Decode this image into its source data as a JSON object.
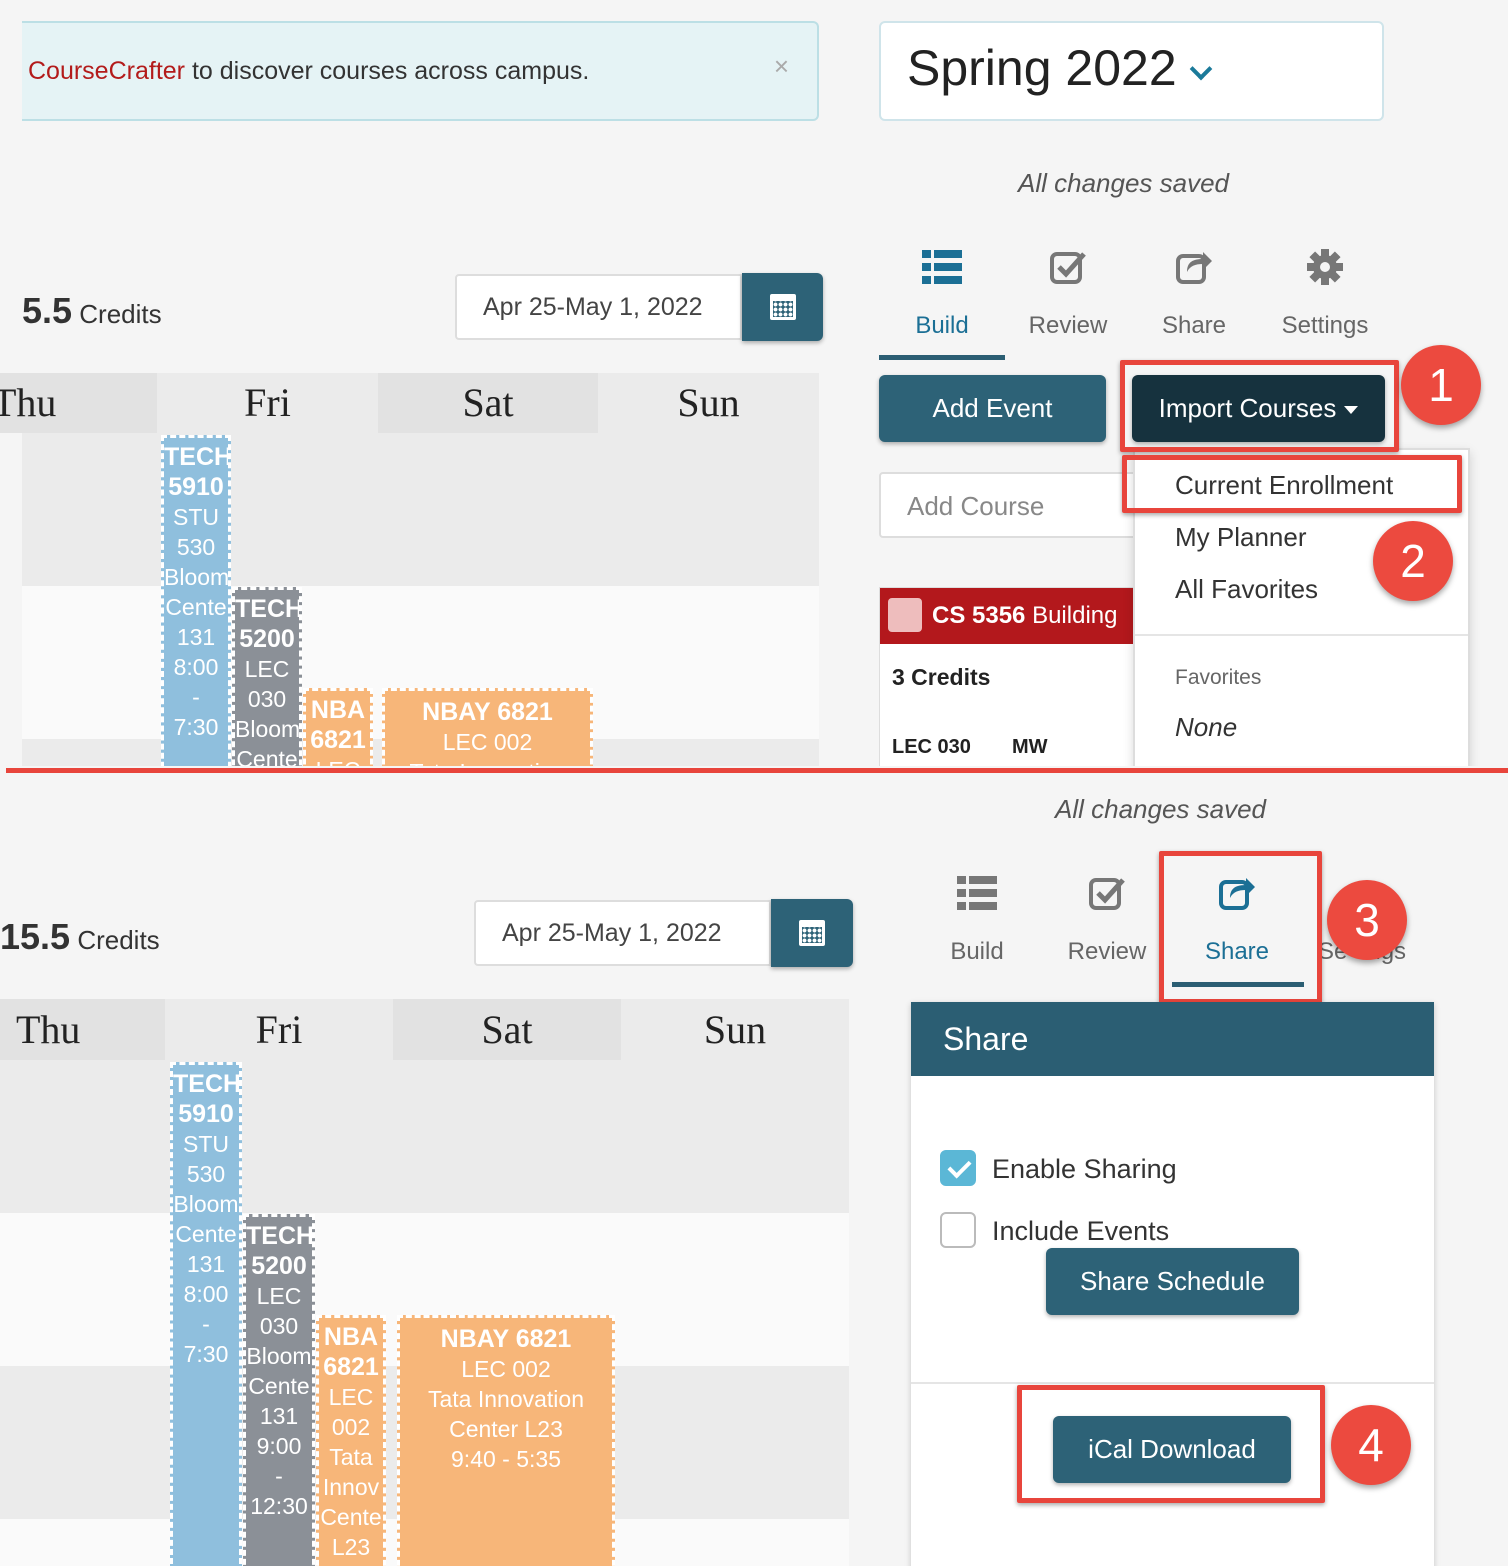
{
  "banner": {
    "brand": "CourseCrafter",
    "text": " to discover courses across campus.",
    "close": "×"
  },
  "term": {
    "label": "Spring 2022"
  },
  "status": {
    "saved": "All changes saved"
  },
  "credits_top": {
    "value": "5.5",
    "label": "Credits"
  },
  "credits_bottom": {
    "value": "15.5",
    "label": "Credits"
  },
  "date_range": "Apr 25-May 1, 2022",
  "days": [
    "Thu",
    "Fri",
    "Sat",
    "Sun"
  ],
  "tabs": [
    {
      "label": "Build",
      "icon": "list-icon"
    },
    {
      "label": "Review",
      "icon": "checkbox-icon"
    },
    {
      "label": "Share",
      "icon": "share-icon"
    },
    {
      "label": "Settings",
      "icon": "gear-icon"
    }
  ],
  "settings_partial": "Se   ngs",
  "build": {
    "add_event": "Add Event",
    "import_courses": "Import Courses",
    "add_course_placeholder": "Add Course",
    "menu": {
      "items": [
        "Current Enrollment",
        "My Planner",
        "All Favorites"
      ],
      "favorites_header": "Favorites",
      "favorites_value": "None"
    },
    "course_card": {
      "code": "CS 5356",
      "name": "Building",
      "credits": "3 Credits",
      "section": "LEC 030",
      "days": "MW"
    }
  },
  "share": {
    "title": "Share",
    "enable_sharing": "Enable Sharing",
    "enable_sharing_checked": true,
    "include_events": "Include Events",
    "include_events_checked": false,
    "share_schedule": "Share Schedule",
    "ical_download": "iCal Download"
  },
  "steps": [
    "1",
    "2",
    "3",
    "4"
  ],
  "events": {
    "tech5910": [
      "TECH",
      "5910",
      "STU",
      "530",
      "Bloom",
      "Cente",
      "131",
      "8:00",
      "-",
      "7:30"
    ],
    "tech5200": [
      "TECH",
      "5200",
      "LEC",
      "030",
      "Bloom",
      "Cente",
      "131",
      "9:00",
      "-",
      "12:30"
    ],
    "nbay_narrow": [
      "NBA",
      "6821",
      "LEC",
      "002",
      "Tata",
      "Innov",
      "Cente",
      "L23"
    ],
    "nbay_wide": [
      "NBAY 6821",
      "LEC 002",
      "Tata Innovation",
      "Center L23",
      "9:40 - 5:35"
    ]
  },
  "colors": {
    "accent": "#2d6277",
    "brand_red": "#b31b1b",
    "annotation_red": "#e8453c",
    "event_blue": "#8fbfdd",
    "event_gray": "#8b9097",
    "event_orange": "#f7b679"
  }
}
